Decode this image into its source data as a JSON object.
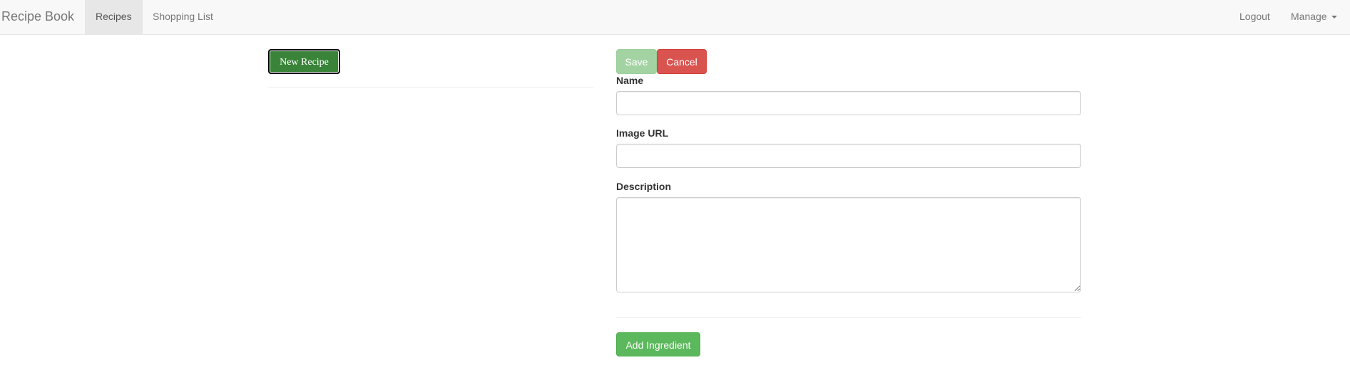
{
  "navbar": {
    "brand": "Recipe Book",
    "items": [
      {
        "label": "Recipes",
        "active": true
      },
      {
        "label": "Shopping List",
        "active": false
      }
    ],
    "right_items": [
      {
        "label": "Logout"
      },
      {
        "label": "Manage",
        "has_dropdown": true
      }
    ]
  },
  "recipe_list": {
    "new_recipe_label": "New Recipe"
  },
  "recipe_form": {
    "save_label": "Save",
    "cancel_label": "Cancel",
    "fields": {
      "name": {
        "label": "Name",
        "value": ""
      },
      "image_url": {
        "label": "Image URL",
        "value": ""
      },
      "description": {
        "label": "Description",
        "value": ""
      }
    },
    "add_ingredient_label": "Add Ingredient"
  },
  "colors": {
    "success": "#5cb85c",
    "success_dark": "#398439",
    "success_disabled": "#a3d3a3",
    "danger": "#d9534f",
    "navbar_bg": "#f8f8f8"
  }
}
